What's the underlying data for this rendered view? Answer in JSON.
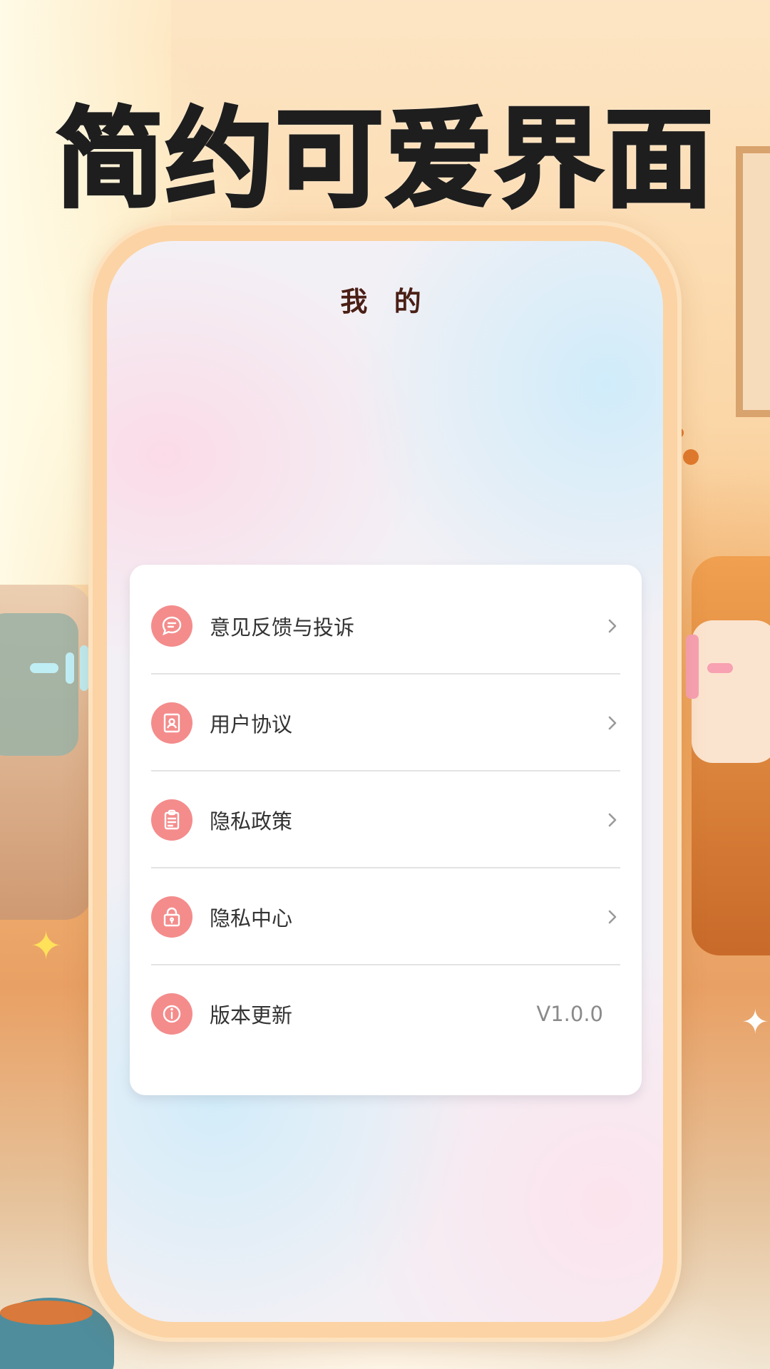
{
  "headline": "简约可爱界面",
  "screen": {
    "title": "我 的"
  },
  "menu": {
    "items": [
      {
        "label": "意见反馈与投诉",
        "icon": "feedback-icon"
      },
      {
        "label": "用户协议",
        "icon": "agreement-icon"
      },
      {
        "label": "隐私政策",
        "icon": "clipboard-icon"
      },
      {
        "label": "隐私中心",
        "icon": "lock-icon"
      },
      {
        "label": "版本更新",
        "icon": "info-icon",
        "value": "V1.0.0"
      }
    ]
  },
  "colors": {
    "accent_icon": "#f48c8c",
    "title_text": "#4a1f16",
    "frame": "#fcd3a4"
  }
}
